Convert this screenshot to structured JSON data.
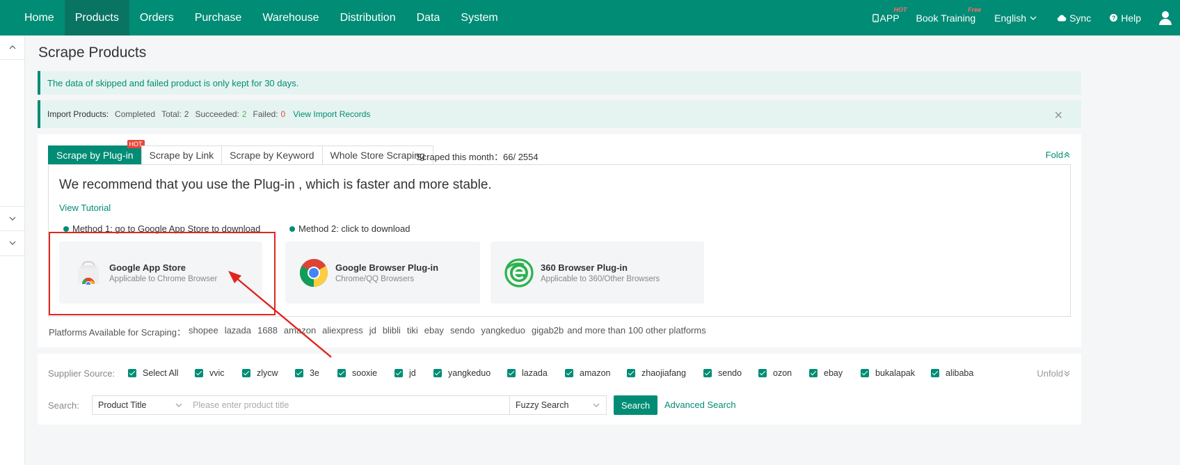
{
  "nav": {
    "items": [
      "Home",
      "Products",
      "Orders",
      "Purchase",
      "Warehouse",
      "Distribution",
      "Data",
      "System"
    ],
    "right": {
      "app": "APP",
      "app_badge": "HOT",
      "training": "Book Training",
      "training_badge": "Free",
      "language": "English",
      "sync": "Sync",
      "help": "Help"
    }
  },
  "page": {
    "title": "Scrape Products",
    "notice": "The data of skipped and failed product is only kept for 30 days."
  },
  "import": {
    "label": "Import Products:",
    "status": "Completed",
    "total_label": "Total:",
    "total": "2",
    "succeeded_label": "Succeeded:",
    "succeeded": "2",
    "failed_label": "Failed:",
    "failed": "0",
    "records_link": "View Import Records",
    "close": "✕"
  },
  "tabs": [
    {
      "label": "Scrape by Plug-in",
      "badge": "HOT"
    },
    {
      "label": "Scrape by Link"
    },
    {
      "label": "Scrape by Keyword"
    },
    {
      "label": "Whole Store Scraping"
    }
  ],
  "scraped": {
    "label": "Scraped this month：",
    "value": "66/ 2554"
  },
  "fold": "Fold",
  "plugin": {
    "recommend": "We recommend that you use the Plug-in , which is faster and more stable.",
    "tutorial": "View Tutorial",
    "method1": "Method 1: go to Google App Store to download",
    "method2": "Method 2: click to download",
    "cards": [
      {
        "title": "Google App Store",
        "subtitle": "Applicable to Chrome Browser",
        "icon": "chrome-store-icon"
      },
      {
        "title": "Google Browser Plug-in",
        "subtitle": "Chrome/QQ Browsers",
        "icon": "chrome-icon"
      },
      {
        "title": "360 Browser Plug-in",
        "subtitle": "Applicable to 360/Other Browsers",
        "icon": "360-browser-icon"
      }
    ]
  },
  "platforms": {
    "label": "Platforms Available for Scraping：",
    "items": [
      "shopee",
      "lazada",
      "1688",
      "amazon",
      "aliexpress",
      "jd",
      "blibli",
      "tiki",
      "ebay",
      "sendo",
      "yangkeduo",
      "gigab2b"
    ],
    "more": "and more than 100 other platforms"
  },
  "filter": {
    "source_label": "Supplier Source:",
    "sources": [
      "Select All",
      "vvic",
      "zlycw",
      "3e",
      "sooxie",
      "jd",
      "yangkeduo",
      "lazada",
      "amazon",
      "zhaojiafang",
      "sendo",
      "ozon",
      "ebay",
      "bukalapak",
      "alibaba"
    ],
    "unfold": "Unfold",
    "search_label": "Search:",
    "field": "Product Title",
    "placeholder": "Please enter product title",
    "mode": "Fuzzy Search",
    "search_button": "Search",
    "advanced": "Advanced Search"
  },
  "colors": {
    "primary": "#008c75",
    "annotation": "#e0251f"
  }
}
